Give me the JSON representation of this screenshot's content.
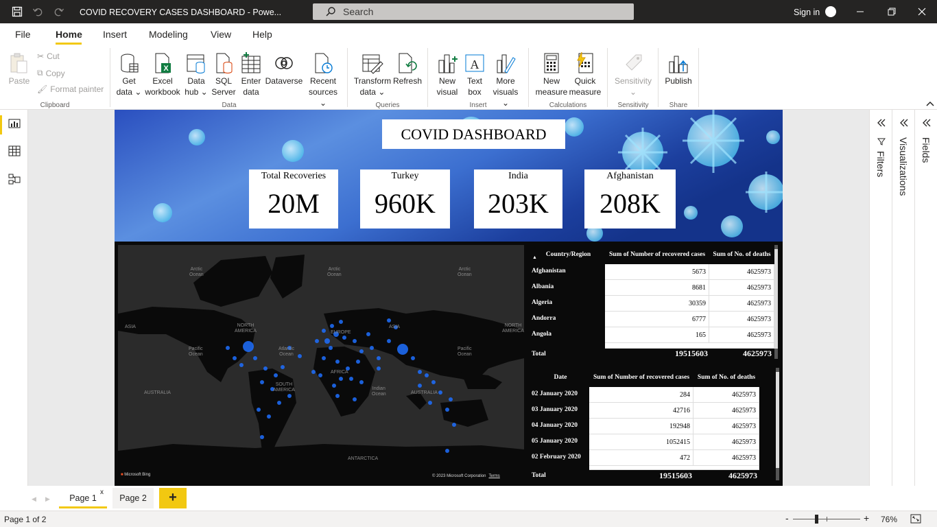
{
  "titlebar": {
    "title": "COVID RECOVERY CASES DASHBOARD - Powe...",
    "search_label": "Search",
    "sign_in": "Sign in"
  },
  "menu": [
    "File",
    "Home",
    "Insert",
    "Modeling",
    "View",
    "Help"
  ],
  "menu_active": "Home",
  "ribbon": {
    "clipboard": {
      "paste": "Paste",
      "cut": "Cut",
      "copy": "Copy",
      "format_painter": "Format painter",
      "group": "Clipboard"
    },
    "data": {
      "get_data": [
        "Get",
        "data ⌄"
      ],
      "excel": [
        "Excel",
        "workbook"
      ],
      "data_hub": [
        "Data",
        "hub ⌄"
      ],
      "sql": [
        "SQL",
        "Server"
      ],
      "enter": [
        "Enter",
        "data"
      ],
      "dataverse": "Dataverse",
      "recent": [
        "Recent",
        "sources ⌄"
      ],
      "group": "Data"
    },
    "queries": {
      "transform": [
        "Transform",
        "data ⌄"
      ],
      "refresh": "Refresh",
      "group": "Queries"
    },
    "insert": {
      "new_visual": [
        "New",
        "visual"
      ],
      "text_box": [
        "Text",
        "box"
      ],
      "more_visuals": [
        "More",
        "visuals ⌄"
      ],
      "group": "Insert"
    },
    "calculations": {
      "new_measure": [
        "New",
        "measure"
      ],
      "quick_measure": [
        "Quick",
        "measure"
      ],
      "group": "Calculations"
    },
    "sensitivity": {
      "label": "Sensitivity",
      "group": "Sensitivity"
    },
    "share": {
      "publish": "Publish",
      "group": "Share"
    }
  },
  "dashboard": {
    "title": "COVID DASHBOARD",
    "cards": [
      {
        "label": "Total Recoveries",
        "value": "20M"
      },
      {
        "label": "Turkey",
        "value": "960K"
      },
      {
        "label": "India",
        "value": "203K"
      },
      {
        "label": "Afghanistan",
        "value": "208K"
      }
    ]
  },
  "map": {
    "labels": {
      "arctic_ocean_1": "Arctic\nOcean",
      "arctic_ocean_2": "Arctic\nOcean",
      "arctic_ocean_3": "Arctic\nOcean",
      "asia_1": "ASIA",
      "north_america_1": "NORTH\nAMERICA",
      "europe": "EUROPE",
      "asia_2": "ASIA",
      "north_america_2": "NORTH\nAMERICA",
      "pacific_1": "Pacific\nOcean",
      "atlantic": "Atlantic\nOcean",
      "pacific_2": "Pacific\nOcean",
      "africa": "AFRICA",
      "south_america": "SOUTH\nAMERICA",
      "australia_1": "AUSTRALIA",
      "indian": "Indian\nOcean",
      "australia_2": "AUSTRALIA",
      "antarctica": "ANTARCTICA"
    },
    "attribution": "Microsoft Bing",
    "copyright": "© 2023 Microsoft Corporation",
    "terms": "Terms"
  },
  "country_table": {
    "headers": [
      "Country/Region",
      "Sum of Number of recovered cases",
      "Sum of No. of deaths"
    ],
    "rows": [
      [
        "Afghanistan",
        "5673",
        "4625973"
      ],
      [
        "Albania",
        "8681",
        "4625973"
      ],
      [
        "Algeria",
        "30359",
        "4625973"
      ],
      [
        "Andorra",
        "6777",
        "4625973"
      ],
      [
        "Angola",
        "165",
        "4625973"
      ]
    ],
    "total": [
      "Total",
      "19515603",
      "4625973"
    ]
  },
  "date_table": {
    "headers": [
      "Date",
      "Sum of Number of recovered cases",
      "Sum of No. of deaths"
    ],
    "rows": [
      [
        "02 January 2020",
        "284",
        "4625973"
      ],
      [
        "03 January 2020",
        "42716",
        "4625973"
      ],
      [
        "04 January 2020",
        "192948",
        "4625973"
      ],
      [
        "05 January 2020",
        "1052415",
        "4625973"
      ],
      [
        "02 February 2020",
        "472",
        "4625973"
      ]
    ],
    "total": [
      "Total",
      "19515603",
      "4625973"
    ]
  },
  "panes": {
    "filters": "Filters",
    "visualizations": "Visualizations",
    "fields": "Fields"
  },
  "pages": {
    "page1": "Page 1",
    "page2": "Page 2",
    "close": "x",
    "add": "+"
  },
  "status": {
    "page": "Page 1 of 2",
    "zoom": "76%",
    "minus": "-",
    "plus": "+"
  },
  "colors": {
    "accent": "#f2c811",
    "titlebar": "#252423",
    "map_dots": "#1e6fff"
  }
}
